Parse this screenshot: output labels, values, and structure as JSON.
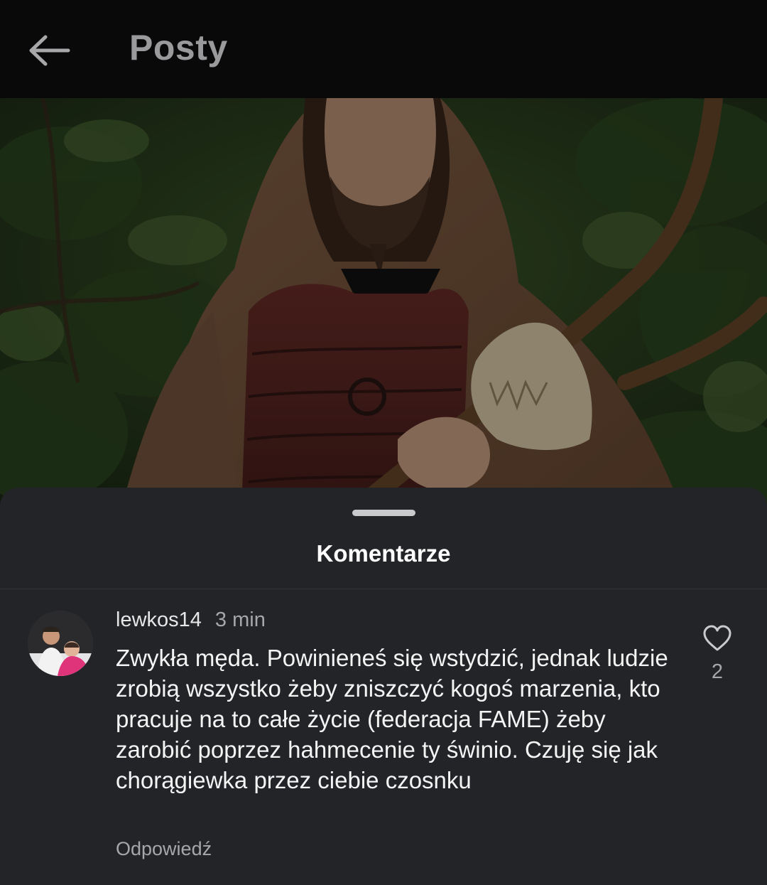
{
  "header": {
    "title": "Posty",
    "back_icon": "arrow-left-icon"
  },
  "post": {
    "image_description_icon": "photo"
  },
  "comments_sheet": {
    "title": "Komentarze"
  },
  "comments": [
    {
      "username": "lewkos14",
      "time": "3 min",
      "text": "Zwykła męda. Powinieneś się wstydzić, jednak ludzie zrobią wszystko żeby zniszczyć kogoś marzenia, kto pracuje na to całe życie (federacja FAME) żeby zarobić poprzez hahmecenie ty świnio. Czuję się jak chorągiewka przez ciebie czosnku",
      "reply_label": "Odpowiedź",
      "like_count": "2",
      "like_icon": "heart-outline-icon"
    }
  ],
  "colors": {
    "background": "#0a0a0b",
    "sheet": "#222427",
    "text_primary": "#f4f4f5",
    "text_secondary": "#a6a7aa"
  }
}
